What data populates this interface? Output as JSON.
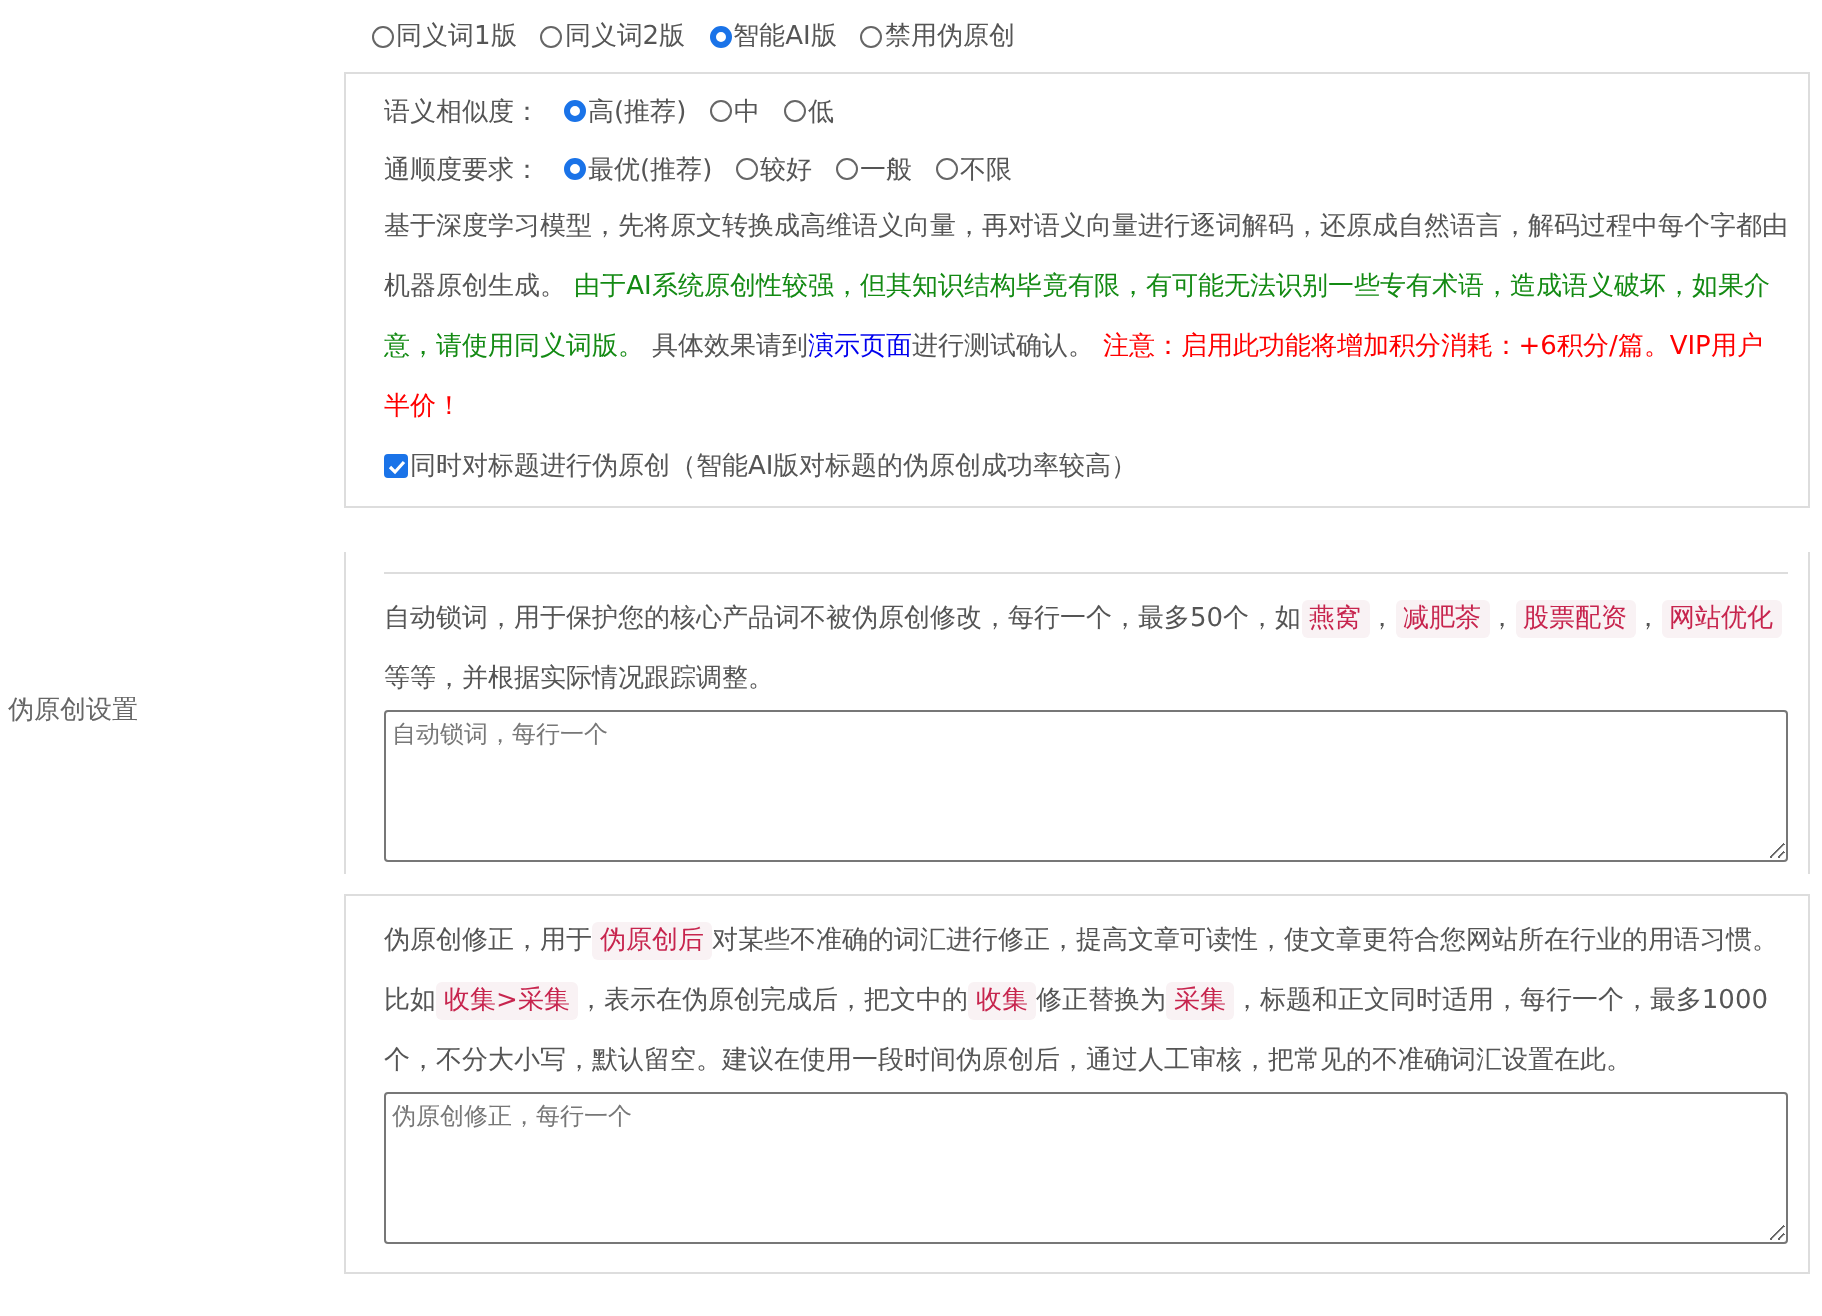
{
  "mode_options": [
    {
      "label": "同义词1版",
      "selected": false
    },
    {
      "label": "同义词2版",
      "selected": false
    },
    {
      "label": "智能AI版",
      "selected": true
    },
    {
      "label": "禁用伪原创",
      "selected": false
    }
  ],
  "ai_settings": {
    "similarity": {
      "label": "语义相似度：",
      "options": [
        {
          "label": "高(推荐)",
          "selected": true
        },
        {
          "label": "中",
          "selected": false
        },
        {
          "label": "低",
          "selected": false
        }
      ]
    },
    "fluency": {
      "label": "通顺度要求：",
      "options": [
        {
          "label": "最优(推荐)",
          "selected": true
        },
        {
          "label": "较好",
          "selected": false
        },
        {
          "label": "一般",
          "selected": false
        },
        {
          "label": "不限",
          "selected": false
        }
      ]
    },
    "description": [
      {
        "kind": "plain",
        "text": "基于深度学习模型，先将原文转换成高维语义向量，再对语义向量进行逐词解码，还原成自然语言，解码过程中每个字都由机器原创生成。 "
      },
      {
        "kind": "note",
        "text": "由于AI系统原创性较强，但其知识结构毕竟有限，有可能无法识别一些专有术语，造成语义破坏，如果介意，请使用同义词版。"
      },
      {
        "kind": "plain",
        "text": " 具体效果请到"
      },
      {
        "kind": "link",
        "text": "演示页面"
      },
      {
        "kind": "plain",
        "text": "进行测试确认。 "
      },
      {
        "kind": "warning",
        "text": "注意：启用此功能将增加积分消耗：+6积分/篇。VIP用户半价！"
      }
    ],
    "title_option": {
      "label": "同时对标题进行伪原创（智能AI版对标题的伪原创成功率较高）",
      "checked": true
    }
  },
  "settings_label": "伪原创设置",
  "lock_words": {
    "description": [
      {
        "kind": "plain",
        "text": "自动锁词，用于保护您的核心产品词不被伪原创修改，每行一个，最多50个，如"
      },
      {
        "kind": "tag",
        "text": "燕窝"
      },
      {
        "kind": "plain",
        "text": "，"
      },
      {
        "kind": "tag",
        "text": "减肥茶"
      },
      {
        "kind": "plain",
        "text": "，"
      },
      {
        "kind": "tag",
        "text": "股票配资"
      },
      {
        "kind": "plain",
        "text": "，"
      },
      {
        "kind": "tag",
        "text": "网站优化"
      },
      {
        "kind": "plain",
        "text": " 等等，并根据实际情况跟踪调整。"
      }
    ],
    "placeholder": "自动锁词，每行一个"
  },
  "corrections": {
    "description": [
      {
        "kind": "plain",
        "text": "伪原创修正，用于"
      },
      {
        "kind": "tag",
        "text": "伪原创后"
      },
      {
        "kind": "plain",
        "text": "对某些不准确的词汇进行修正，提高文章可读性，使文章更符合您网站所在行业的用语习惯。比如"
      },
      {
        "kind": "tag",
        "text": "收集>采集"
      },
      {
        "kind": "plain",
        "text": "，表示在伪原创完成后，把文中的"
      },
      {
        "kind": "tag",
        "text": "收集"
      },
      {
        "kind": "plain",
        "text": "修正替换为"
      },
      {
        "kind": "tag",
        "text": "采集"
      },
      {
        "kind": "plain",
        "text": "，标题和正文同时适用，每行一个，最多1000个，不分大小写，默认留空。建议在使用一段时间伪原创后，通过人工审核，把常见的不准确词汇设置在此。"
      }
    ],
    "placeholder": "伪原创修正，每行一个"
  }
}
